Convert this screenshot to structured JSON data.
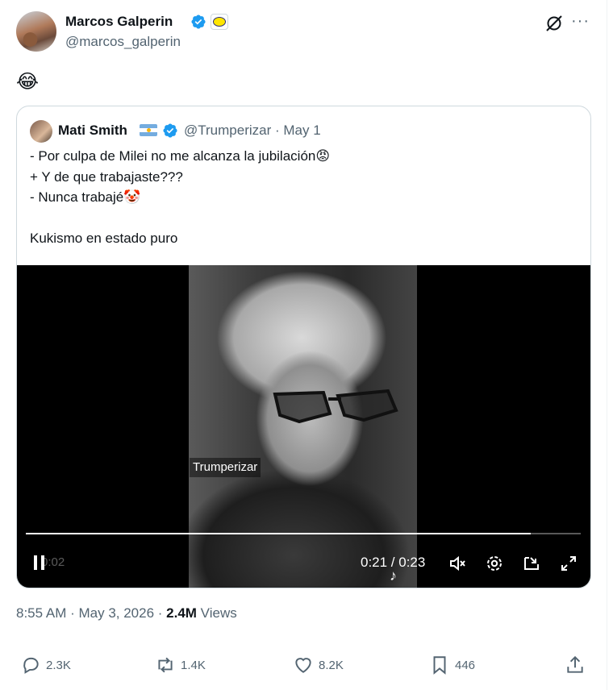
{
  "tweet": {
    "author": {
      "name": "Marcos Galperin",
      "handle": "@marcos_galperin",
      "affiliate_icon": "mercadolibre-handshake-icon"
    },
    "text": "😂",
    "quote": {
      "author_name": "Mati Smith",
      "handle_date": "@Trumperizar · May 1",
      "text": "- Por culpa de Milei no me alcanza la jubilación😡\n+ Y de que trabajaste???\n- Nunca trabajé🤡\n\nKukismo en estado puro",
      "video": {
        "watermark": "Trumperizar",
        "ghost_time": "0:02",
        "time": "0:21 / 0:23",
        "progress": 0.91
      }
    },
    "timestamp": "8:55 AM · May 3, 2026 · ",
    "views_count": "2.4M",
    "views_label": " Views"
  },
  "actions": {
    "replies": "2.3K",
    "reposts": "1.4K",
    "likes": "8.2K",
    "bookmarks": "446"
  },
  "colors": {
    "verified": "#1d9bf0",
    "text": "#0f1419",
    "secondary": "#536471"
  }
}
